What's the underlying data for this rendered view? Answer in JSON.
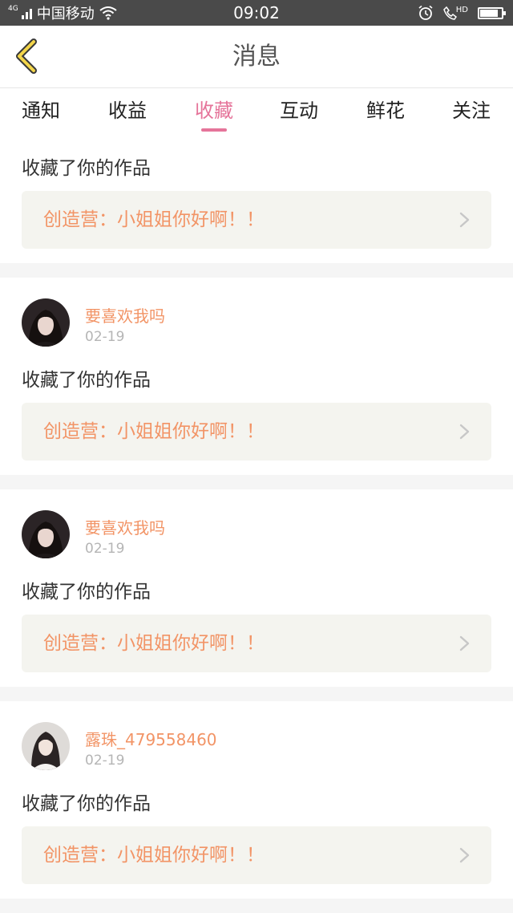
{
  "status_bar": {
    "network_tag": "4G",
    "carrier": "中国移动",
    "time": "09:02",
    "hd_label": "HD",
    "icons": [
      "signal-icon",
      "wifi-icon",
      "alarm-icon",
      "call-hd-icon",
      "battery-icon"
    ]
  },
  "header": {
    "title": "消息",
    "back_icon": "chevron-left-icon"
  },
  "tabs": [
    {
      "label": "通知",
      "active": false
    },
    {
      "label": "收益",
      "active": false
    },
    {
      "label": "收藏",
      "active": true
    },
    {
      "label": "互动",
      "active": false
    },
    {
      "label": "鲜花",
      "active": false
    },
    {
      "label": "关注",
      "active": false
    }
  ],
  "colors": {
    "accent_pink": "#e5749a",
    "username_orange": "#f29466",
    "back_icon_yellow": "#f3d54a"
  },
  "items": [
    {
      "action": "收藏了你的作品",
      "work_title": "创造营：小姐姐你好啊！！"
    },
    {
      "username": "要喜欢我吗",
      "date": "02-19",
      "action": "收藏了你的作品",
      "work_title": "创造营：小姐姐你好啊！！"
    },
    {
      "username": "要喜欢我吗",
      "date": "02-19",
      "action": "收藏了你的作品",
      "work_title": "创造营：小姐姐你好啊！！"
    },
    {
      "username": "露珠_479558460",
      "date": "02-19",
      "action": "收藏了你的作品",
      "work_title": "创造营：小姐姐你好啊！！"
    }
  ]
}
